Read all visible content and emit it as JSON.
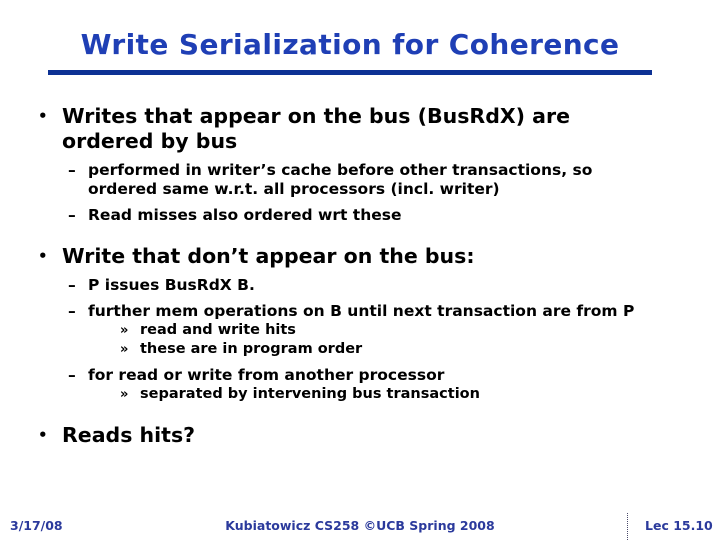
{
  "slide": {
    "title": "Write Serialization for Coherence",
    "bullets": [
      {
        "level": 1,
        "marker": "•",
        "text": "Writes that appear on the bus (BusRdX) are ordered by bus"
      },
      {
        "level": 2,
        "marker": "–",
        "text": "performed in writer’s cache before other transactions, so ordered same w.r.t. all processors (incl. writer)"
      },
      {
        "level": 2,
        "marker": "–",
        "text": "Read misses also ordered wrt these"
      },
      {
        "level": 1,
        "marker": "•",
        "text": "Write that don’t appear on the bus:"
      },
      {
        "level": 2,
        "marker": "–",
        "text": "P issues BusRdX B."
      },
      {
        "level": 2,
        "marker": "–",
        "text": "further mem operations on B until next transaction are from P"
      },
      {
        "level": 3,
        "marker": "»",
        "text": "read and write hits"
      },
      {
        "level": 3,
        "marker": "»",
        "text": "these are in program order"
      },
      {
        "level": 2,
        "marker": "–",
        "text": "for read or write from another processor"
      },
      {
        "level": 3,
        "marker": "»",
        "text": "separated by intervening bus transaction"
      },
      {
        "level": 1,
        "marker": "•",
        "text": "Reads hits?"
      }
    ]
  },
  "footer": {
    "date": "3/17/08",
    "center": "Kubiatowicz CS258 ©UCB Spring 2008",
    "lecture": "Lec 15.10"
  },
  "colors": {
    "title": "#1f3fb5",
    "rule": "#0d3194",
    "footer": "#2b3a9c",
    "body": "#000000"
  }
}
